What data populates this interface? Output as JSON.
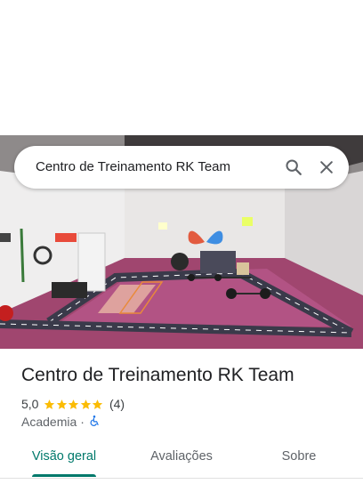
{
  "search": {
    "query": "Centro de Treinamento RK Team",
    "search_icon": "search-icon",
    "close_icon": "close-icon"
  },
  "place": {
    "name": "Centro de Treinamento RK Team",
    "rating": "5,0",
    "stars": 5,
    "review_count": "(4)",
    "category": "Academia",
    "separator": "·",
    "accessibility_icon": "wheelchair-icon"
  },
  "photo": {
    "subject": "gym-interior-photo"
  },
  "tabs": [
    {
      "label": "Visão geral",
      "active": true
    },
    {
      "label": "Avaliações",
      "active": false
    },
    {
      "label": "Sobre",
      "active": false
    }
  ],
  "colors": {
    "accent": "#00796b",
    "star": "#fbbc04",
    "accessibility": "#1a73e8"
  }
}
